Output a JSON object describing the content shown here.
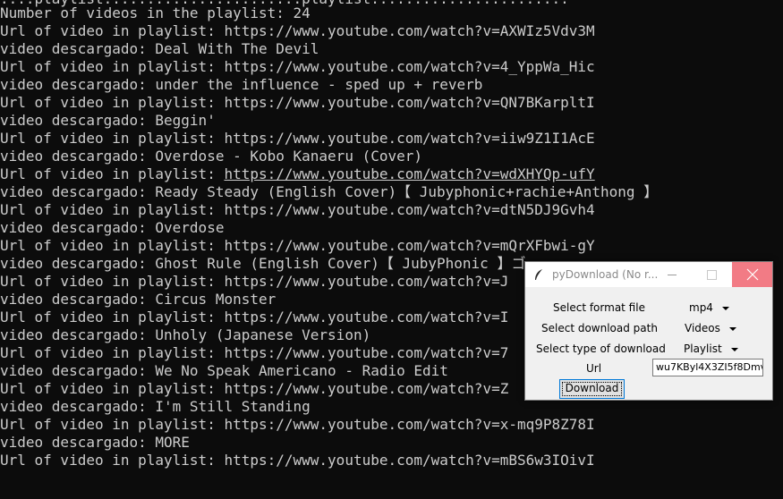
{
  "terminal": {
    "top_partial": "....playlist.......................playlist.......................",
    "lines": [
      "Number of videos in the playlist: 24",
      "Url of video in playlist: https://www.youtube.com/watch?v=AXWIz5Vdv3M",
      "video descargado: Deal With The Devil",
      "Url of video in playlist: https://www.youtube.com/watch?v=4_YppWa_Hic",
      "video descargado: under the influence - sped up + reverb",
      "Url of video in playlist: https://www.youtube.com/watch?v=QN7BKarpltI",
      "video descargado: Beggin'",
      "Url of video in playlist: https://www.youtube.com/watch?v=iiw9Z1I1AcE",
      "video descargado: Overdose - Kobo Kanaeru (Cover)",
      "Url of video in playlist: https://www.youtube.com/watch?v=wdXHYQp-ufY",
      "video descargado: Ready Steady (English Cover)【 Jubyphonic+rachie+Anthong 】",
      "Url of video in playlist: https://www.youtube.com/watch?v=dtN5DJ9Gvh4",
      "video descargado: Overdose",
      "Url of video in playlist: https://www.youtube.com/watch?v=mQrXFbwi-gY",
      "video descargado: Ghost Rule (English Cover)【 JubyPhonic 】ゴ",
      "Url of video in playlist: https://www.youtube.com/watch?v=J",
      "video descargado: Circus Monster",
      "Url of video in playlist: https://www.youtube.com/watch?v=I",
      "video descargado: Unholy (Japanese Version)",
      "Url of video in playlist: https://www.youtube.com/watch?v=7",
      "video descargado: We No Speak Americano - Radio Edit",
      "Url of video in playlist: https://www.youtube.com/watch?v=Z",
      "video descargado: I'm Still Standing",
      "Url of video in playlist: https://www.youtube.com/watch?v=x-mq9P8Z78I",
      "video descargado: MORE",
      "Url of video in playlist: https://www.youtube.com/watch?v=mBS6w3IOivI"
    ]
  },
  "window": {
    "title": "pyDownload (No r...",
    "icon": "feather-icon",
    "labels": {
      "format": "Select format file",
      "path": "Select download path",
      "type": "Select type of download",
      "url": "Url"
    },
    "format_value": "mp4",
    "path_value": "Videos",
    "type_value": "Playlist",
    "url_value": "wu7KByl4X3ZI5f8Dmv",
    "download_label": "Download",
    "close_color": "#e81123"
  }
}
